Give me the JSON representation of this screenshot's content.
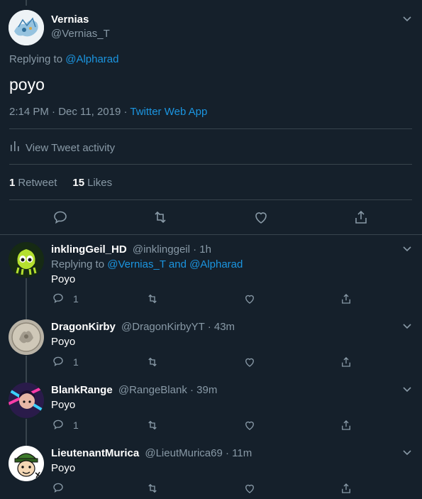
{
  "main_tweet": {
    "display_name": "Vernias",
    "handle": "@Vernias_T",
    "replying_prefix": "Replying to",
    "replying_to": "@Alpharad",
    "text": "poyo",
    "timestamp": "2:14 PM · Dec 11, 2019 · ",
    "source": "Twitter Web App",
    "activity_label": "View Tweet activity",
    "retweets_count": "1",
    "retweets_label": "Retweet",
    "likes_count": "15",
    "likes_label": "Likes"
  },
  "replies": [
    {
      "display_name": "inklingGeil_HD",
      "handle": "@inklinggeil",
      "time": "· 1h",
      "replying_prefix": "Replying to",
      "replying_to": "@Vernias_T and @Alpharad",
      "text": "Poyo",
      "reply_count": "1"
    },
    {
      "display_name": "DragonKirby",
      "handle": "@DragonKirbyYT",
      "time": "· 43m",
      "text": "Poyo",
      "reply_count": "1"
    },
    {
      "display_name": "BlankRange",
      "handle": "@RangeBlank",
      "time": "· 39m",
      "text": "Poyo",
      "reply_count": "1"
    },
    {
      "display_name": "LieutenantMurica",
      "handle": "@LieutMurica69",
      "time": "· 11m",
      "text": "Poyo",
      "reply_count": ""
    }
  ],
  "colors": {
    "background": "#15202b",
    "border": "#38444d",
    "muted": "#8899a6",
    "link": "#1b95e0",
    "text": "#ffffff"
  },
  "icons": {
    "caret": "chevron-down-icon",
    "reply": "reply-icon",
    "retweet": "retweet-icon",
    "like": "heart-icon",
    "share": "share-icon",
    "activity": "bar-chart-icon"
  }
}
